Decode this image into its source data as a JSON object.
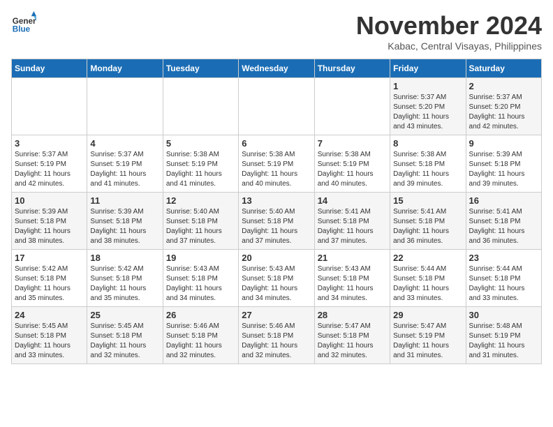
{
  "logo": {
    "line1": "General",
    "line2": "Blue"
  },
  "title": "November 2024",
  "location": "Kabac, Central Visayas, Philippines",
  "days_of_week": [
    "Sunday",
    "Monday",
    "Tuesday",
    "Wednesday",
    "Thursday",
    "Friday",
    "Saturday"
  ],
  "weeks": [
    [
      {
        "day": "",
        "info": ""
      },
      {
        "day": "",
        "info": ""
      },
      {
        "day": "",
        "info": ""
      },
      {
        "day": "",
        "info": ""
      },
      {
        "day": "",
        "info": ""
      },
      {
        "day": "1",
        "info": "Sunrise: 5:37 AM\nSunset: 5:20 PM\nDaylight: 11 hours\nand 43 minutes."
      },
      {
        "day": "2",
        "info": "Sunrise: 5:37 AM\nSunset: 5:20 PM\nDaylight: 11 hours\nand 42 minutes."
      }
    ],
    [
      {
        "day": "3",
        "info": "Sunrise: 5:37 AM\nSunset: 5:19 PM\nDaylight: 11 hours\nand 42 minutes."
      },
      {
        "day": "4",
        "info": "Sunrise: 5:37 AM\nSunset: 5:19 PM\nDaylight: 11 hours\nand 41 minutes."
      },
      {
        "day": "5",
        "info": "Sunrise: 5:38 AM\nSunset: 5:19 PM\nDaylight: 11 hours\nand 41 minutes."
      },
      {
        "day": "6",
        "info": "Sunrise: 5:38 AM\nSunset: 5:19 PM\nDaylight: 11 hours\nand 40 minutes."
      },
      {
        "day": "7",
        "info": "Sunrise: 5:38 AM\nSunset: 5:19 PM\nDaylight: 11 hours\nand 40 minutes."
      },
      {
        "day": "8",
        "info": "Sunrise: 5:38 AM\nSunset: 5:18 PM\nDaylight: 11 hours\nand 39 minutes."
      },
      {
        "day": "9",
        "info": "Sunrise: 5:39 AM\nSunset: 5:18 PM\nDaylight: 11 hours\nand 39 minutes."
      }
    ],
    [
      {
        "day": "10",
        "info": "Sunrise: 5:39 AM\nSunset: 5:18 PM\nDaylight: 11 hours\nand 38 minutes."
      },
      {
        "day": "11",
        "info": "Sunrise: 5:39 AM\nSunset: 5:18 PM\nDaylight: 11 hours\nand 38 minutes."
      },
      {
        "day": "12",
        "info": "Sunrise: 5:40 AM\nSunset: 5:18 PM\nDaylight: 11 hours\nand 37 minutes."
      },
      {
        "day": "13",
        "info": "Sunrise: 5:40 AM\nSunset: 5:18 PM\nDaylight: 11 hours\nand 37 minutes."
      },
      {
        "day": "14",
        "info": "Sunrise: 5:41 AM\nSunset: 5:18 PM\nDaylight: 11 hours\nand 37 minutes."
      },
      {
        "day": "15",
        "info": "Sunrise: 5:41 AM\nSunset: 5:18 PM\nDaylight: 11 hours\nand 36 minutes."
      },
      {
        "day": "16",
        "info": "Sunrise: 5:41 AM\nSunset: 5:18 PM\nDaylight: 11 hours\nand 36 minutes."
      }
    ],
    [
      {
        "day": "17",
        "info": "Sunrise: 5:42 AM\nSunset: 5:18 PM\nDaylight: 11 hours\nand 35 minutes."
      },
      {
        "day": "18",
        "info": "Sunrise: 5:42 AM\nSunset: 5:18 PM\nDaylight: 11 hours\nand 35 minutes."
      },
      {
        "day": "19",
        "info": "Sunrise: 5:43 AM\nSunset: 5:18 PM\nDaylight: 11 hours\nand 34 minutes."
      },
      {
        "day": "20",
        "info": "Sunrise: 5:43 AM\nSunset: 5:18 PM\nDaylight: 11 hours\nand 34 minutes."
      },
      {
        "day": "21",
        "info": "Sunrise: 5:43 AM\nSunset: 5:18 PM\nDaylight: 11 hours\nand 34 minutes."
      },
      {
        "day": "22",
        "info": "Sunrise: 5:44 AM\nSunset: 5:18 PM\nDaylight: 11 hours\nand 33 minutes."
      },
      {
        "day": "23",
        "info": "Sunrise: 5:44 AM\nSunset: 5:18 PM\nDaylight: 11 hours\nand 33 minutes."
      }
    ],
    [
      {
        "day": "24",
        "info": "Sunrise: 5:45 AM\nSunset: 5:18 PM\nDaylight: 11 hours\nand 33 minutes."
      },
      {
        "day": "25",
        "info": "Sunrise: 5:45 AM\nSunset: 5:18 PM\nDaylight: 11 hours\nand 32 minutes."
      },
      {
        "day": "26",
        "info": "Sunrise: 5:46 AM\nSunset: 5:18 PM\nDaylight: 11 hours\nand 32 minutes."
      },
      {
        "day": "27",
        "info": "Sunrise: 5:46 AM\nSunset: 5:18 PM\nDaylight: 11 hours\nand 32 minutes."
      },
      {
        "day": "28",
        "info": "Sunrise: 5:47 AM\nSunset: 5:18 PM\nDaylight: 11 hours\nand 32 minutes."
      },
      {
        "day": "29",
        "info": "Sunrise: 5:47 AM\nSunset: 5:19 PM\nDaylight: 11 hours\nand 31 minutes."
      },
      {
        "day": "30",
        "info": "Sunrise: 5:48 AM\nSunset: 5:19 PM\nDaylight: 11 hours\nand 31 minutes."
      }
    ]
  ]
}
